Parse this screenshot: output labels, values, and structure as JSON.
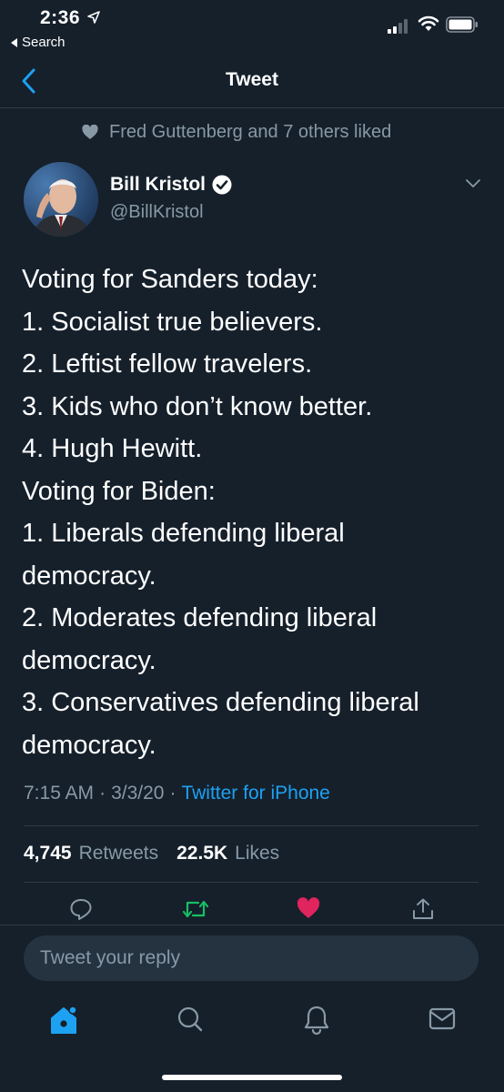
{
  "status_bar": {
    "time": "2:36",
    "back_app_label": "Search"
  },
  "nav": {
    "title": "Tweet"
  },
  "social_context": {
    "text": "Fred Guttenberg and 7 others liked"
  },
  "user": {
    "name": "Bill Kristol",
    "handle": "@BillKristol"
  },
  "tweet": {
    "lines": [
      "Voting for Sanders today:",
      "1. Socialist true believers.",
      "2. Leftist fellow travelers.",
      "3. Kids who don’t know better.",
      "4. Hugh Hewitt.",
      "Voting for Biden:",
      "1. Liberals defending liberal democracy.",
      "2. Moderates defending liberal democracy.",
      "3. Conservatives defending liberal democracy."
    ],
    "time": "7:15 AM",
    "date": "3/3/20",
    "separator": "·",
    "source": "Twitter for iPhone"
  },
  "stats": {
    "retweets_count": "4,745",
    "retweets_label": "Retweets",
    "likes_count": "22.5K",
    "likes_label": "Likes"
  },
  "reply": {
    "placeholder": "Tweet your reply"
  },
  "icons": {
    "reply": "reply-icon",
    "retweet": "retweet-icon",
    "like": "heart-icon",
    "share": "share-icon",
    "home": "home-icon",
    "search": "search-icon",
    "notifications": "bell-icon",
    "messages": "mail-icon"
  },
  "colors": {
    "background": "#15202b",
    "accent": "#1da1f2",
    "retweet": "#17bf63",
    "like": "#e0245e",
    "secondary": "#8899a6"
  }
}
